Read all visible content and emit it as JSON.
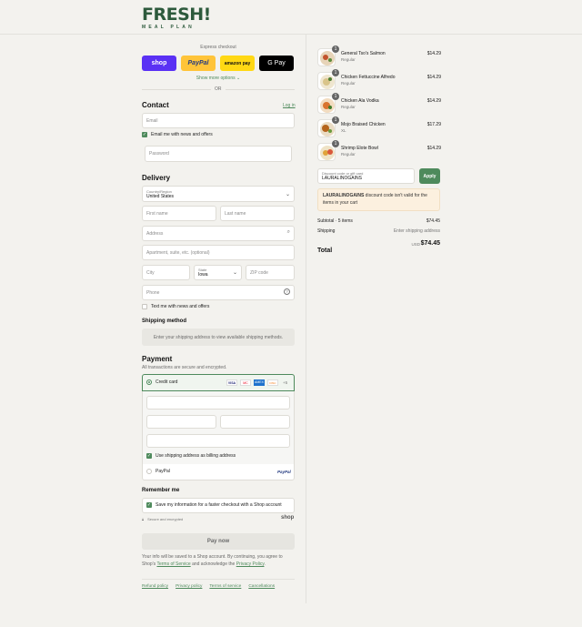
{
  "brand": {
    "name": "FRESH!",
    "tagline": "MEAL PLAN"
  },
  "express": {
    "label": "Express checkout",
    "buttons": [
      "shop",
      "PayPal",
      "amazon pay",
      "G Pay"
    ],
    "more": "Show more options",
    "or": "OR"
  },
  "contact": {
    "title": "Contact",
    "login": "Log in",
    "email_placeholder": "Email",
    "news_label": "Email me with news and offers",
    "password_placeholder": "Password"
  },
  "delivery": {
    "title": "Delivery",
    "country_label": "Country/Region",
    "country_value": "United States",
    "first_name": "First name",
    "last_name": "Last name",
    "address": "Address",
    "apartment": "Apartment, suite, etc. (optional)",
    "city": "City",
    "state_label": "State",
    "state_value": "Iowa",
    "zip": "ZIP code",
    "phone": "Phone",
    "text_label": "Text me with news and offers"
  },
  "shipping": {
    "title": "Shipping method",
    "message": "Enter your shipping address to view available shipping methods."
  },
  "payment": {
    "title": "Payment",
    "subtitle": "All transactions are secure and encrypted.",
    "credit_card": "Credit card",
    "card_more": "+5",
    "billing_label": "Use shipping address as billing address",
    "paypal": "PayPal",
    "card_brands": [
      "VISA",
      "MC",
      "AMEX",
      "DISC"
    ]
  },
  "remember": {
    "title": "Remember me",
    "save_label": "Save my information for a faster checkout with a Shop account",
    "secure": "Secure and encrypted",
    "shop": "shop"
  },
  "pay_now": "Pay now",
  "legal": {
    "text1": "Your info will be saved to a Shop account. By continuing, you agree to Shop's",
    "terms": "Terms of Service",
    "and": "and acknowledge the",
    "privacy": "Privacy Policy"
  },
  "footer": [
    "Refund policy",
    "Privacy policy",
    "Terms of service",
    "Cancellations"
  ],
  "cart": {
    "items": [
      {
        "qty": "1",
        "name": "General Tso's Salmon",
        "variant": "Regular",
        "price": "$14.29"
      },
      {
        "qty": "1",
        "name": "Chicken Fettuccine Alfredo",
        "variant": "Regular",
        "price": "$14.29"
      },
      {
        "qty": "1",
        "name": "Chicken Ala Vodka",
        "variant": "Regular",
        "price": "$14.29"
      },
      {
        "qty": "1",
        "name": "Mojo Braised Chicken",
        "variant": "XL",
        "price": "$17.29"
      },
      {
        "qty": "1",
        "name": "Shrimp Elote Bowl",
        "variant": "Regular",
        "price": "$14.29"
      }
    ],
    "discount_label": "Discount code or gift card",
    "discount_value": "LAURALINOGAINS",
    "apply": "Apply",
    "warning_code": "LAURALINOGAINS",
    "warning_text": "discount code isn't valid for the items in your cart",
    "subtotal_label": "Subtotal · 5 items",
    "subtotal_value": "$74.45",
    "shipping_label": "Shipping",
    "shipping_value": "Enter shipping address",
    "total_label": "Total",
    "currency": "USD",
    "total_value": "$74.45"
  },
  "colors": {
    "brand_green": "#2d5a3c",
    "accent": "#4e8a5c",
    "shop_purple": "#5a31f4",
    "paypal_yellow": "#ffc439"
  }
}
